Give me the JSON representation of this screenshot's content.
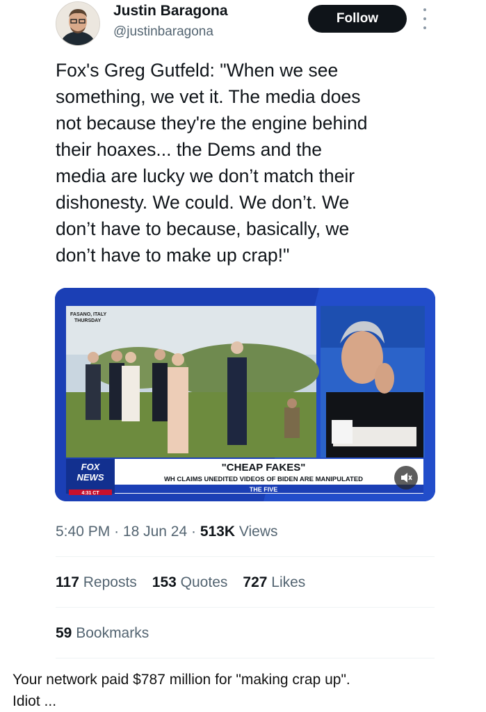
{
  "author": {
    "name": "Justin Baragona",
    "handle": "@justinbaragona",
    "follow_label": "Follow"
  },
  "tweet": {
    "text": "Fox's Greg Gutfeld:  \"When we see\nsomething, we vet it. The media does\nnot because they're the engine behind\ntheir hoaxes... the Dems and the\nmedia are lucky we don’t match their\ndishonesty. We could. We don’t. We\ndon’t have to because, basically, we\ndon’t have to make up crap!\""
  },
  "media": {
    "location_line1": "FASANO, ITALY",
    "location_line2": "THURSDAY",
    "logo_line1": "FOX",
    "logo_line2": "NEWS",
    "time": "4:31 CT",
    "headline": "\"CHEAP FAKES\"",
    "subline": "WH CLAIMS UNEDITED VIDEOS OF BIDEN ARE MANIPULATED",
    "show": "THE FIVE",
    "mute_icon": "speaker-muted-icon"
  },
  "meta": {
    "time": "5:40 PM",
    "date": "18 Jun 24",
    "views_count": "513K",
    "views_label": "Views"
  },
  "stats": {
    "reposts_count": "117",
    "reposts_label": "Reposts",
    "quotes_count": "153",
    "quotes_label": "Quotes",
    "likes_count": "727",
    "likes_label": "Likes",
    "bookmarks_count": "59",
    "bookmarks_label": "Bookmarks"
  },
  "reply": {
    "text": "Your network paid $787 million for \"making crap up\".\nIdiot ..."
  },
  "colors": {
    "follow_bg": "#0f1419",
    "fox_blue": "#1b3fb5",
    "fox_red": "#c8102e",
    "muted_text": "#536471"
  }
}
